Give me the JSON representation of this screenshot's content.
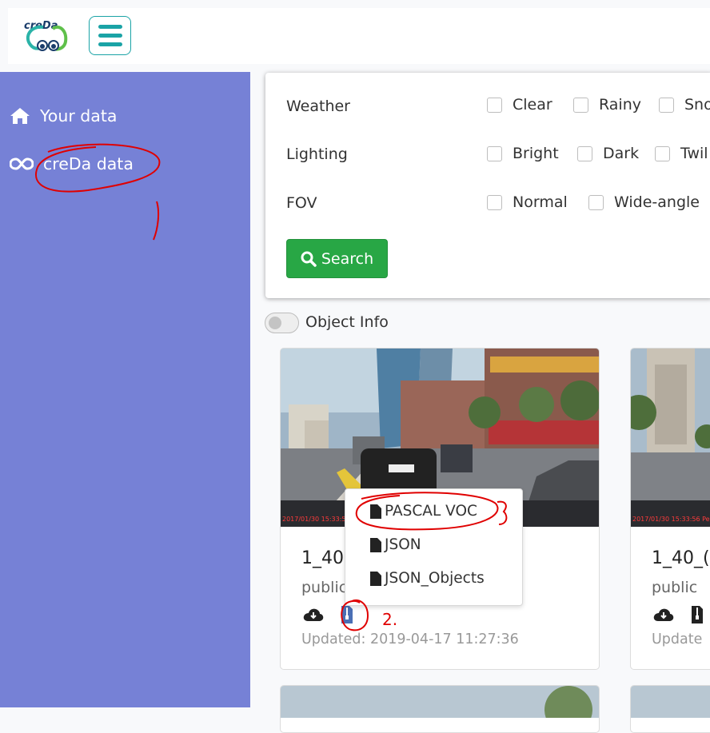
{
  "header": {
    "logo_text": "creDa",
    "menu_button": "hamburger-menu"
  },
  "sidebar": {
    "items": [
      {
        "label": "Your data",
        "icon": "home-icon"
      },
      {
        "label": "creDa data",
        "icon": "infinity-icon"
      }
    ]
  },
  "filters": {
    "weather": {
      "label": "Weather",
      "options": [
        "Clear",
        "Rainy",
        "Sno"
      ]
    },
    "lighting": {
      "label": "Lighting",
      "options": [
        "Bright",
        "Dark",
        "Twil"
      ]
    },
    "fov": {
      "label": "FOV",
      "options": [
        "Normal",
        "Wide-angle"
      ]
    },
    "search_label": "Search"
  },
  "object_info": {
    "label": "Object Info",
    "enabled": false
  },
  "cards": [
    {
      "title": "1_40",
      "visibility": "public",
      "updated": "Updated: 2019-04-17 11:27:36",
      "timestamp": "2017/01/30 15:33:56"
    },
    {
      "title": "1_40_(",
      "visibility": "public",
      "updated": "Update",
      "timestamp": "2017/01/30 15:33:56 Pe"
    }
  ],
  "download_menu": {
    "items": [
      "PASCAL VOC",
      "JSON",
      "JSON_Objects"
    ]
  },
  "annotations": {
    "step2": "2."
  },
  "colors": {
    "sidebar": "#7681d6",
    "accent": "#1aa3a6",
    "search": "#28a745",
    "annotation": "#e00000"
  }
}
